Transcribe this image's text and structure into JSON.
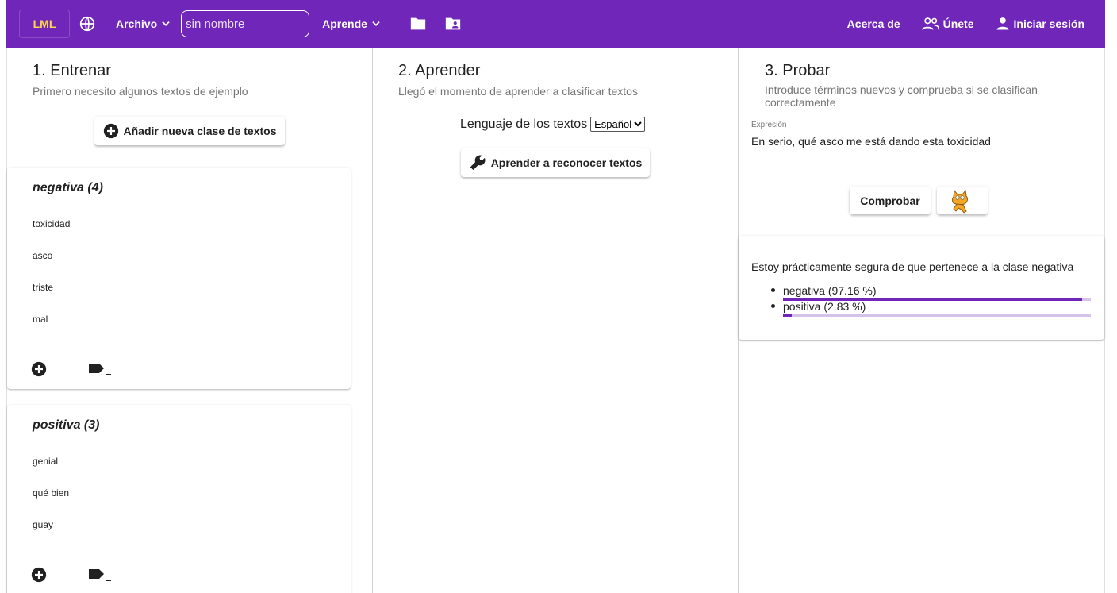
{
  "header": {
    "logo": "LML",
    "file_menu": "Archivo",
    "project_name_placeholder": "sin nombre",
    "learn_menu": "Aprende",
    "about": "Acerca de",
    "join": "Únete",
    "login": "Iniciar sesión",
    "colors": {
      "bar": "#7026b9",
      "logo_text": "#ffd54f"
    },
    "icons": [
      "globe-icon",
      "chevron-down-icon",
      "folder-icon",
      "shared-folder-icon",
      "group-icon",
      "person-icon"
    ]
  },
  "train": {
    "title": "1. Entrenar",
    "subtitle": "Primero necesito algunos textos de ejemplo",
    "add_class_button": "Añadir nueva clase de textos",
    "classes": [
      {
        "title": "negativa (4)",
        "items": [
          "toxicidad",
          "asco",
          "triste",
          "mal"
        ]
      },
      {
        "title": "positiva (3)",
        "items": [
          "genial",
          "qué bien",
          "guay"
        ]
      }
    ]
  },
  "learn": {
    "title": "2. Aprender",
    "subtitle": "Llegó el momento de aprender a clasificar textos",
    "language_label": "Lenguaje de los textos",
    "language_selected": "Español",
    "learn_button": "Aprender a reconocer textos"
  },
  "test": {
    "title": "3. Probar",
    "subtitle": "Introduce términos nuevos y comprueba si se clasifican correctamente",
    "field_label": "Expresión",
    "field_value": "En serio, qué asco me está dando esta toxicidad",
    "check_button": "Comprobar",
    "result_text": "Estoy prácticamente segura de que pertenece a la clase negativa",
    "results": [
      {
        "label": "negativa (97.16 %)",
        "percent": 97.16
      },
      {
        "label": "positiva (2.83 %)",
        "percent": 2.83
      }
    ],
    "accent_color": "#7026b9"
  }
}
